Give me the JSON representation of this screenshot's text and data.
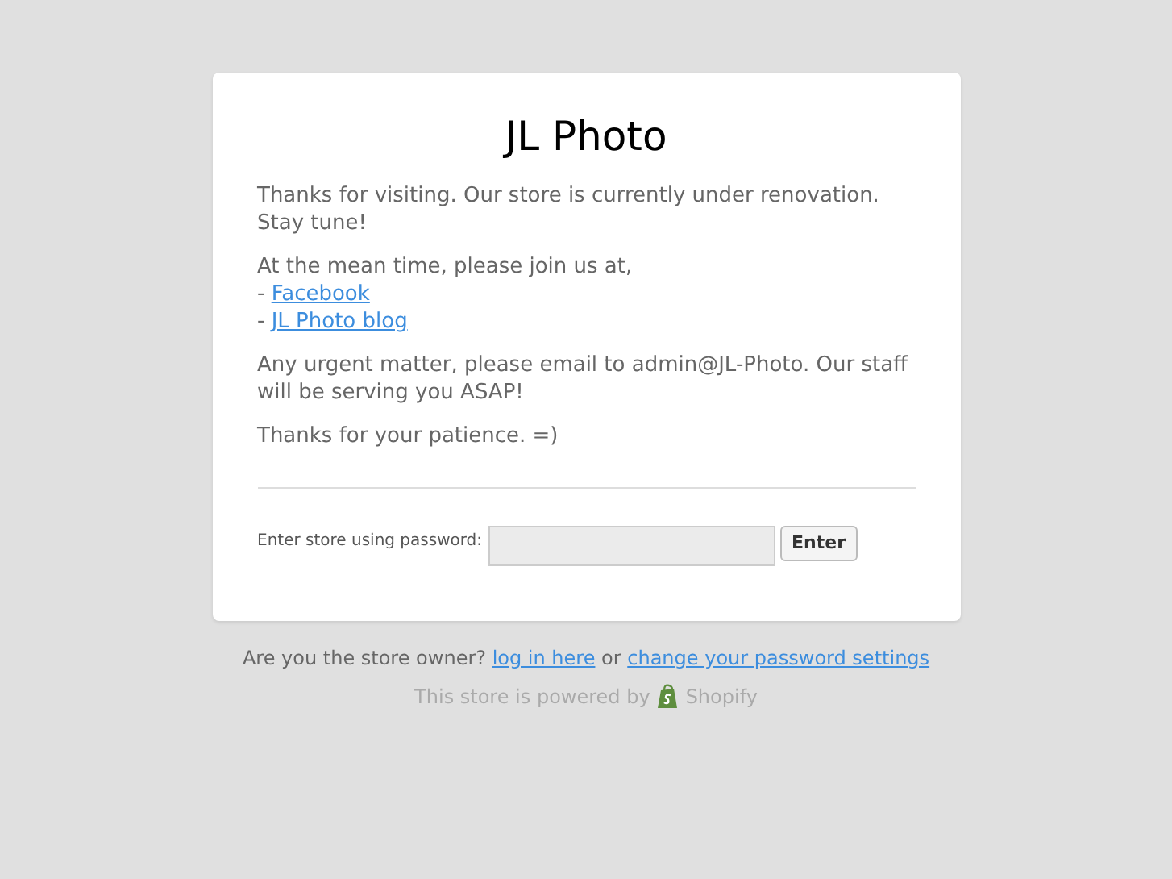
{
  "store_title": "JL Photo",
  "paragraphs": [
    {
      "lines": [
        [
          {
            "kind": "text",
            "text": "Thanks for visiting. Our store is currently under renovation. Stay tune!"
          }
        ]
      ]
    },
    {
      "lines": [
        [
          {
            "kind": "text",
            "text": "At the mean time, please join us at,"
          }
        ],
        [
          {
            "kind": "text",
            "text": "- "
          },
          {
            "kind": "link",
            "text": "Facebook"
          }
        ],
        [
          {
            "kind": "text",
            "text": "- "
          },
          {
            "kind": "link",
            "text": "JL Photo blog"
          }
        ]
      ]
    },
    {
      "lines": [
        [
          {
            "kind": "text",
            "text": "Any urgent matter, please email to admin@JL-Photo. Our staff will be serving you ASAP!"
          }
        ]
      ]
    },
    {
      "lines": [
        [
          {
            "kind": "text",
            "text": "Thanks for your patience. =)"
          }
        ]
      ]
    }
  ],
  "password_form": {
    "label": "Enter store using password:",
    "button": "Enter"
  },
  "footer": {
    "segments": [
      {
        "kind": "text",
        "text": "Are you the store owner? "
      },
      {
        "kind": "link",
        "text": "log in here"
      },
      {
        "kind": "text",
        "text": " or "
      },
      {
        "kind": "link",
        "text": "change your password settings"
      }
    ],
    "powered_by": "This store is powered by",
    "brand": "Shopify"
  }
}
